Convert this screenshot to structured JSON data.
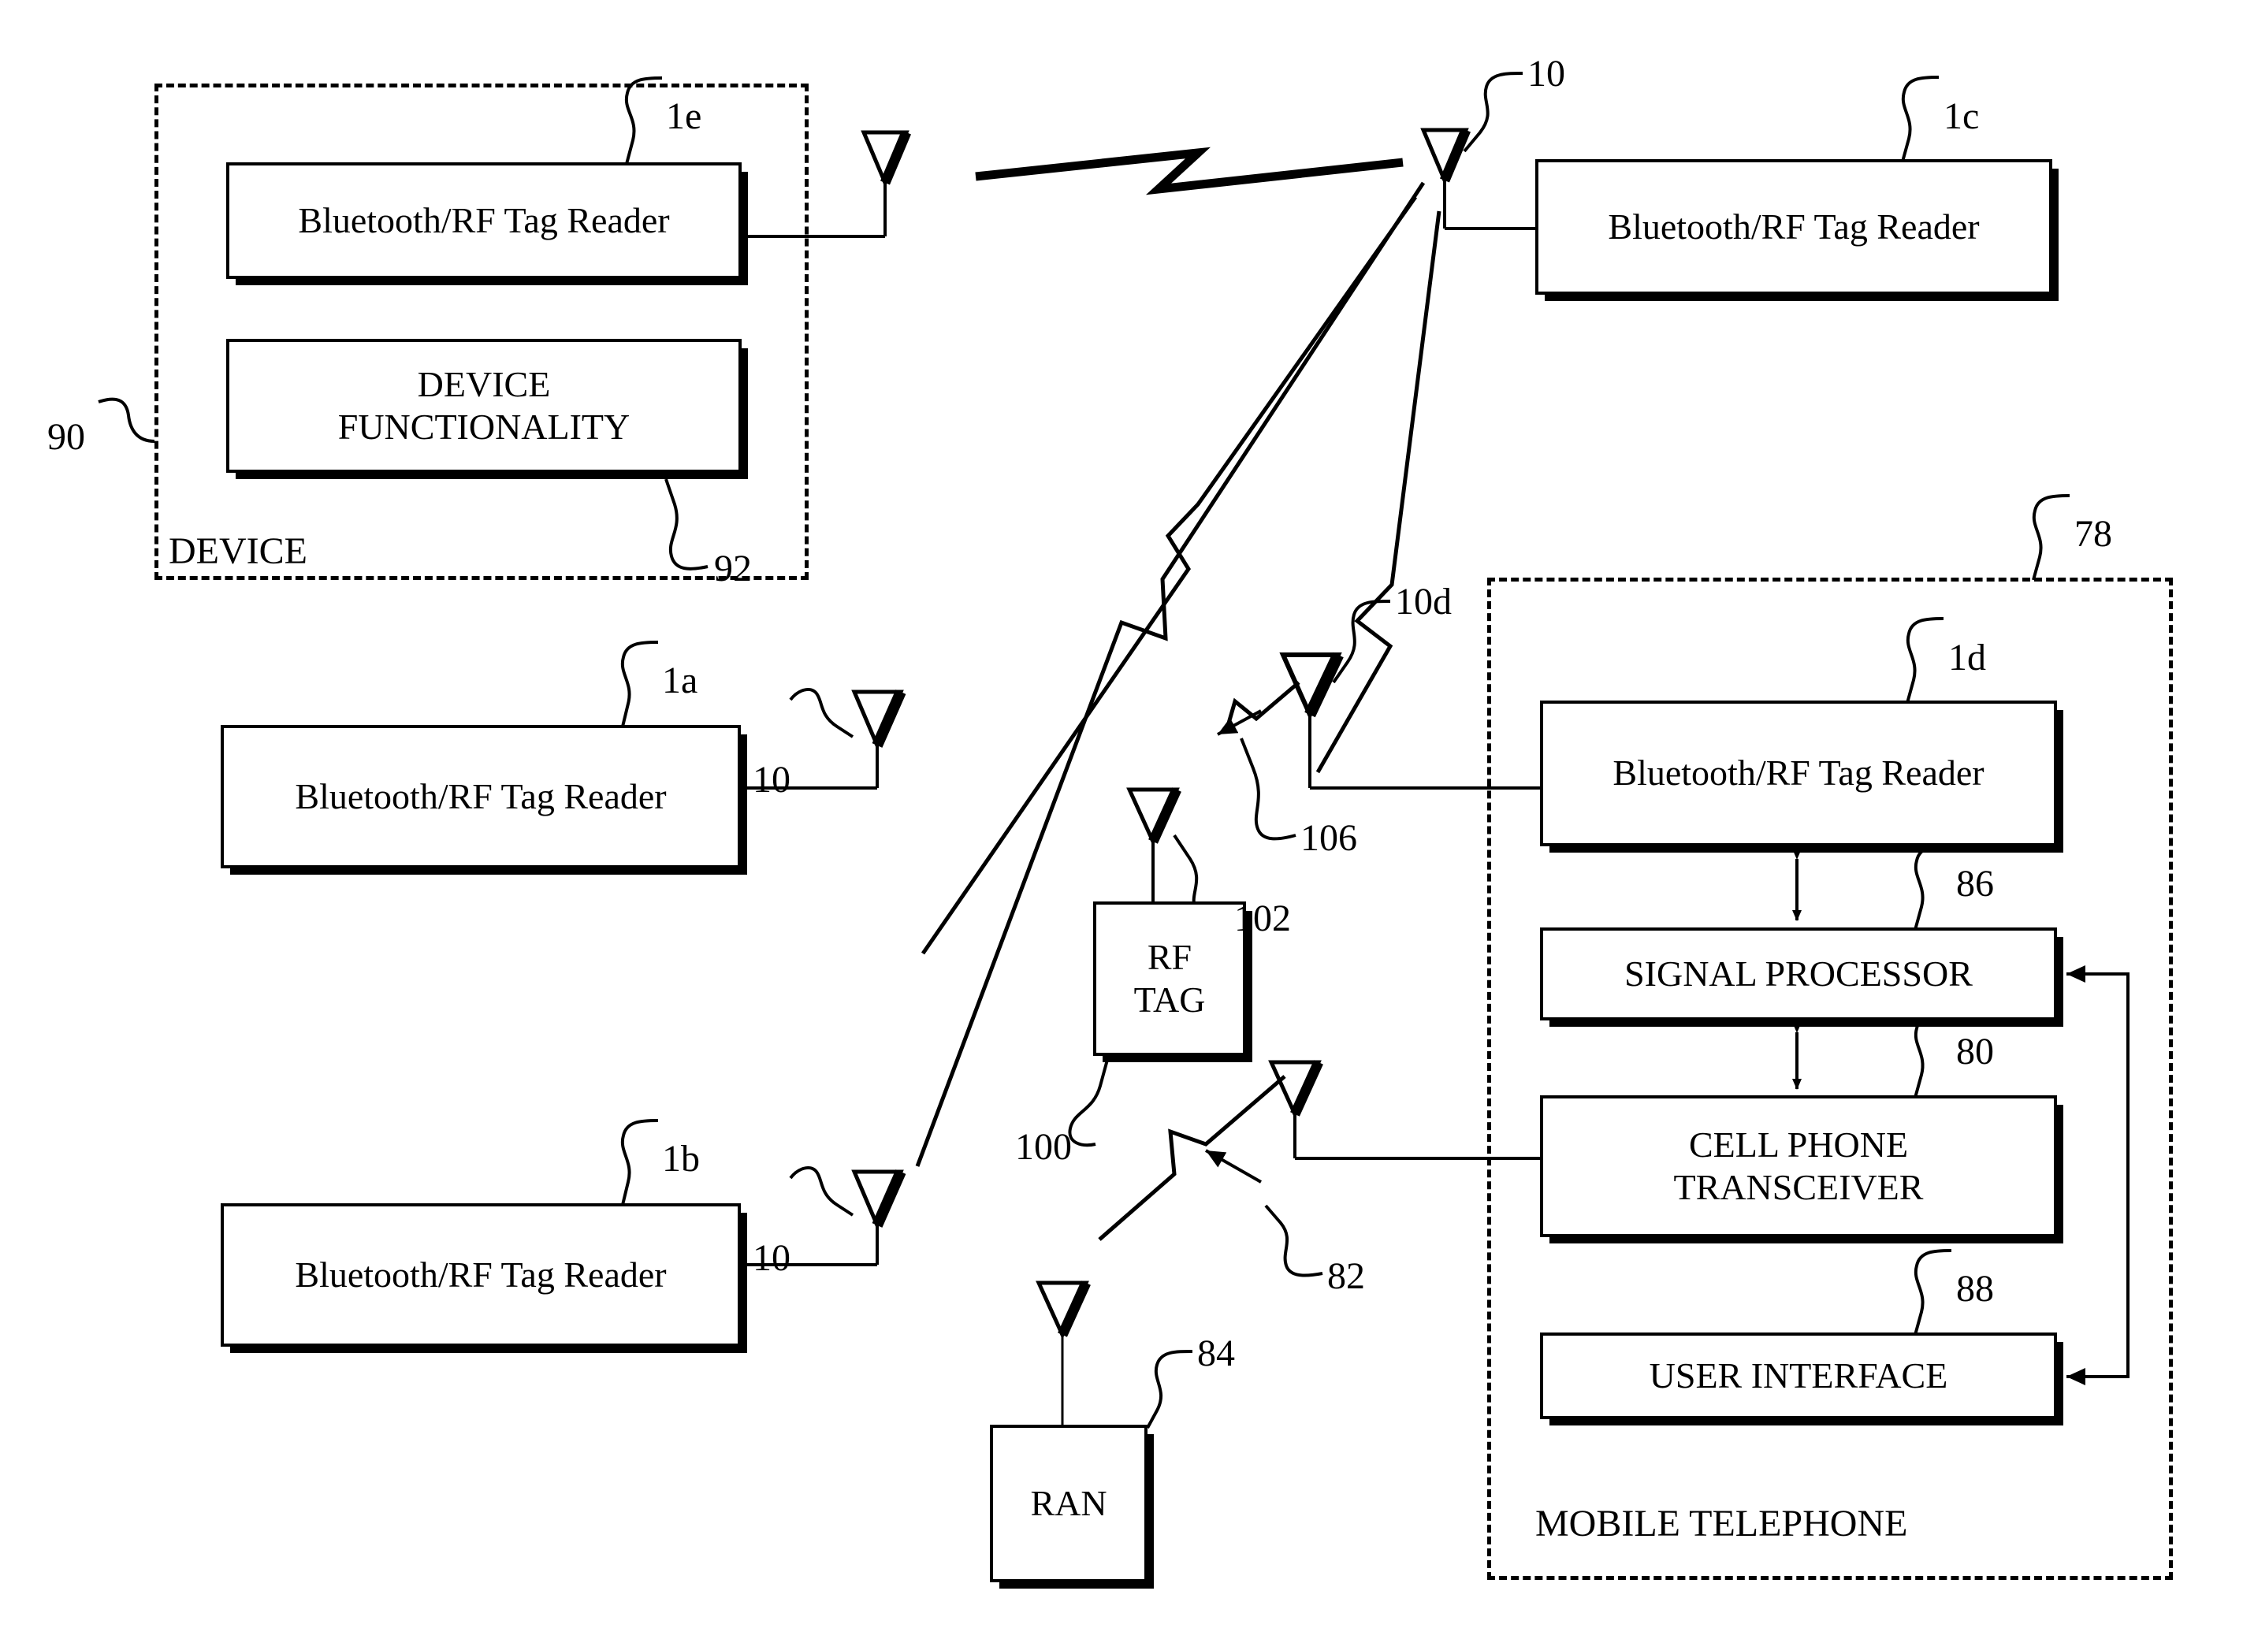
{
  "figure": {
    "type": "patent-block-diagram",
    "enclosures": [
      {
        "id": "device",
        "title": "DEVICE",
        "ref": "90"
      },
      {
        "id": "mobile",
        "title": "MOBILE TELEPHONE",
        "ref": "78"
      }
    ],
    "blocks": [
      {
        "id": "reader_1e",
        "label": "Bluetooth/RF Tag Reader",
        "ref": "1e"
      },
      {
        "id": "device_func",
        "label": "DEVICE FUNCTIONALITY",
        "ref": "92"
      },
      {
        "id": "reader_1a",
        "label": "Bluetooth/RF Tag Reader",
        "ref": "1a"
      },
      {
        "id": "reader_1b",
        "label": "Bluetooth/RF Tag Reader",
        "ref": "1b"
      },
      {
        "id": "reader_1c",
        "label": "Bluetooth/RF Tag Reader",
        "ref": "1c"
      },
      {
        "id": "reader_1d",
        "label": "Bluetooth/RF Tag Reader",
        "ref": "1d"
      },
      {
        "id": "rf_tag",
        "label": "RF TAG",
        "ref": "100"
      },
      {
        "id": "ran",
        "label": "RAN",
        "ref": "84"
      },
      {
        "id": "signal_proc",
        "label": "SIGNAL PROCESSOR",
        "ref": "86"
      },
      {
        "id": "cell_trx",
        "label": "CELL PHONE TRANSCEIVER",
        "ref": "80"
      },
      {
        "id": "user_iface",
        "label": "USER INTERFACE",
        "ref": "88"
      }
    ],
    "labels": {
      "device_functionality_line1": "DEVICE",
      "device_functionality_line2": "FUNCTIONALITY",
      "rf_tag_line1": "RF",
      "rf_tag_line2": "TAG",
      "cell_trx_line1": "CELL PHONE",
      "cell_trx_line2": "TRANSCEIVER",
      "ran": "RAN",
      "signal_processor": "SIGNAL PROCESSOR",
      "user_interface": "USER INTERFACE",
      "reader": "Bluetooth/RF Tag Reader",
      "device_enclosure": "DEVICE",
      "mobile_enclosure": "MOBILE TELEPHONE"
    },
    "refs": {
      "r_1e": "1e",
      "r_1a": "1a",
      "r_1b": "1b",
      "r_1c": "1c",
      "r_1d": "1d",
      "r_90": "90",
      "r_92": "92",
      "r_78": "78",
      "r_86": "86",
      "r_80": "80",
      "r_88": "88",
      "r_84": "84",
      "r_82": "82",
      "r_100": "100",
      "r_102": "102",
      "r_106": "106",
      "r_10_top": "10",
      "r_10_10d": "10d",
      "r_10_1a": "10",
      "r_10_1b": "10"
    },
    "antennas": [
      {
        "id": "ant_1e",
        "ref": ""
      },
      {
        "id": "ant_hub",
        "ref": "10"
      },
      {
        "id": "ant_1a",
        "ref": "10"
      },
      {
        "id": "ant_1b",
        "ref": "10"
      },
      {
        "id": "ant_10d",
        "ref": "10d"
      },
      {
        "id": "ant_102",
        "ref": "102"
      },
      {
        "id": "ant_cell",
        "ref": ""
      },
      {
        "id": "ant_ran",
        "ref": ""
      }
    ],
    "colors": {
      "line": "#000000",
      "background": "#ffffff"
    }
  }
}
